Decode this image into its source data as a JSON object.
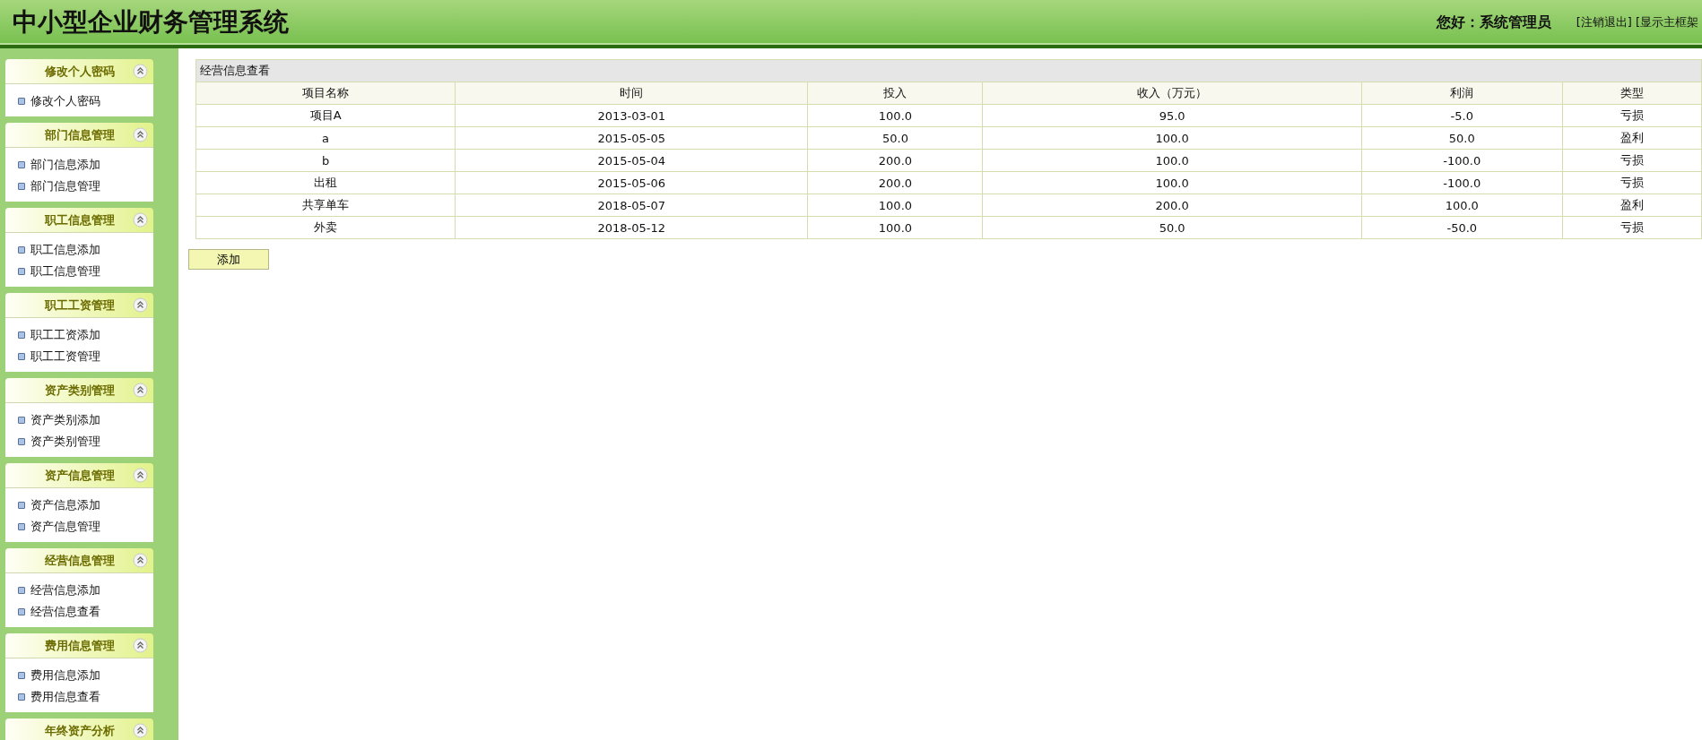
{
  "header": {
    "title": "中小型企业财务管理系统",
    "greeting": "您好：系统管理员",
    "links": [
      "[注销退出]",
      "[显示主框架"
    ]
  },
  "sidebar": {
    "groups": [
      {
        "title": "修改个人密码",
        "items": [
          "修改个人密码"
        ]
      },
      {
        "title": "部门信息管理",
        "items": [
          "部门信息添加",
          "部门信息管理"
        ]
      },
      {
        "title": "职工信息管理",
        "items": [
          "职工信息添加",
          "职工信息管理"
        ]
      },
      {
        "title": "职工工资管理",
        "items": [
          "职工工资添加",
          "职工工资管理"
        ]
      },
      {
        "title": "资产类别管理",
        "items": [
          "资产类别添加",
          "资产类别管理"
        ]
      },
      {
        "title": "资产信息管理",
        "items": [
          "资产信息添加",
          "资产信息管理"
        ]
      },
      {
        "title": "经营信息管理",
        "items": [
          "经营信息添加",
          "经营信息查看"
        ]
      },
      {
        "title": "费用信息管理",
        "items": [
          "费用信息添加",
          "费用信息查看"
        ]
      },
      {
        "title": "年终资产分析"
      }
    ]
  },
  "panel": {
    "title": "经营信息查看",
    "table": {
      "columns": [
        "项目名称",
        "时间",
        "投入",
        "收入（万元）",
        "利润",
        "类型"
      ],
      "rows": [
        [
          "项目A",
          "2013-03-01",
          "100.0",
          "95.0",
          "-5.0",
          "亏损"
        ],
        [
          "a",
          "2015-05-05",
          "50.0",
          "100.0",
          "50.0",
          "盈利"
        ],
        [
          "b",
          "2015-05-04",
          "200.0",
          "100.0",
          "-100.0",
          "亏损"
        ],
        [
          "出租",
          "2015-05-06",
          "200.0",
          "100.0",
          "-100.0",
          "亏损"
        ],
        [
          "共享单车",
          "2018-05-07",
          "100.0",
          "200.0",
          "100.0",
          "盈利"
        ],
        [
          "外卖",
          "2018-05-12",
          "100.0",
          "50.0",
          "-50.0",
          "亏损"
        ]
      ]
    },
    "button": "添加"
  }
}
